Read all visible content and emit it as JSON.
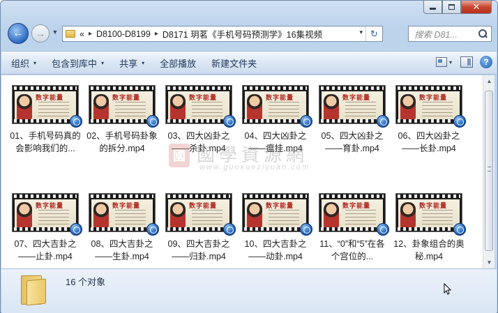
{
  "window": {
    "caption": {
      "minimize": "—",
      "maximize": "□",
      "close": "✕"
    }
  },
  "nav": {
    "back_icon": "back-arrow-icon",
    "forward_icon": "forward-arrow-icon",
    "recent_icon": "chevron-down-icon"
  },
  "address": {
    "overflow": "«",
    "crumbs": [
      "D8100-D8199",
      "D8171 玥茗《手机号码预测学》16集视频"
    ],
    "separator": "▸",
    "dropdown": "▾",
    "refresh": "↻"
  },
  "search": {
    "placeholder": "搜索 D81..."
  },
  "toolbar": {
    "organize": "组织",
    "include_library": "包含到库中",
    "share": "共享",
    "play_all": "全部播放",
    "new_folder": "新建文件夹",
    "caret": "▾",
    "help": "?"
  },
  "files": [
    {
      "name": "01、手机号码真的会影响我们的...",
      "art": "数字能量"
    },
    {
      "name": "02、手机号码卦象的拆分.mp4",
      "art": "数字能量"
    },
    {
      "name": "03、四大凶卦之——杀卦.mp4",
      "art": "数字能量"
    },
    {
      "name": "04、四大凶卦之——瘟挂.mp4",
      "art": "数字能量"
    },
    {
      "name": "05、四大凶卦之——育卦.mp4",
      "art": "数字能量"
    },
    {
      "name": "06、四大凶卦之——长卦.mp4",
      "art": "数字能量"
    },
    {
      "name": "07、四大吉卦之——止卦.mp4",
      "art": "数字能量"
    },
    {
      "name": "08、四大吉卦之——生卦.mp4",
      "art": "数字能量"
    },
    {
      "name": "09、四大吉卦之——归卦.mp4",
      "art": "数字能量"
    },
    {
      "name": "10、四大吉卦之——动卦.mp4",
      "art": "数字能量"
    },
    {
      "name": "11、“0”和“5”在各个宫位的...",
      "art": "数字能量"
    },
    {
      "name": "12、卦象组合的奥秘.mp4",
      "art": "数字能量"
    }
  ],
  "watermark": {
    "seal": "國",
    "cn": "國學資源網",
    "en": "www.guoxueziyuan.com"
  },
  "scrollbar": {
    "up": "▲",
    "down": "▼"
  },
  "details": {
    "count": "16 个对象"
  }
}
